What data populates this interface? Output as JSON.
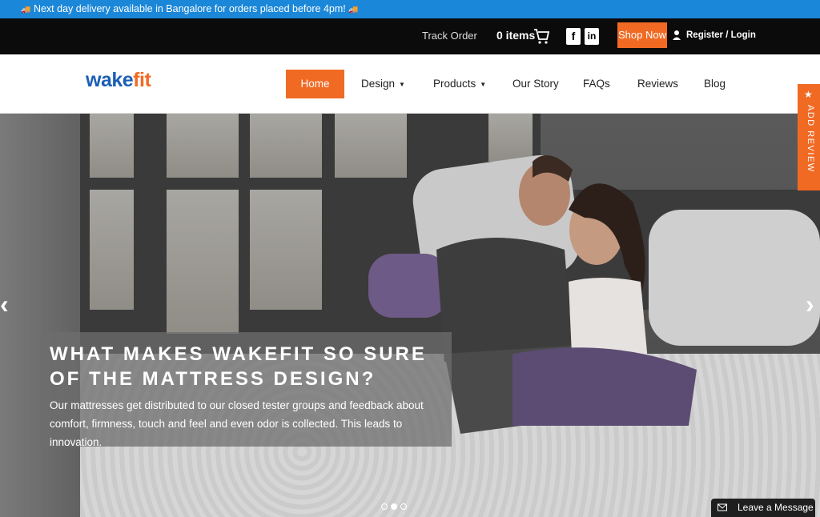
{
  "announcement": {
    "text": "Next day delivery available in Bangalore for orders placed before 4pm!",
    "icon": "truck-icon"
  },
  "topbar": {
    "track_order": "Track Order",
    "cart_items": "0 items",
    "shop_now": "Shop Now",
    "register_login": "Register / Login",
    "facebook": "f",
    "linkedin": "in"
  },
  "nav": {
    "logo": {
      "w": "wa",
      "k": "k",
      "rest": "e",
      "fit": "fit"
    },
    "items": [
      "Home",
      "Design",
      "Products",
      "Our Story",
      "FAQs",
      "Reviews",
      "Blog"
    ]
  },
  "hero": {
    "title": "WHAT MAKES WAKEFIT SO SURE OF THE MATTRESS DESIGN?",
    "body": "Our mattresses get distributed to our closed tester groups and feedback about comfort, firmness, touch and feel and even odor is collected. This leads to innovation.",
    "active_slide": 2,
    "slide_count": 3
  },
  "side_tab": {
    "label": "ADD REVIEW"
  },
  "chat": {
    "label": "Leave a Message"
  },
  "colors": {
    "accent": "#f16a24",
    "announce": "#1b87d8",
    "topbar": "#0b0b0b"
  }
}
